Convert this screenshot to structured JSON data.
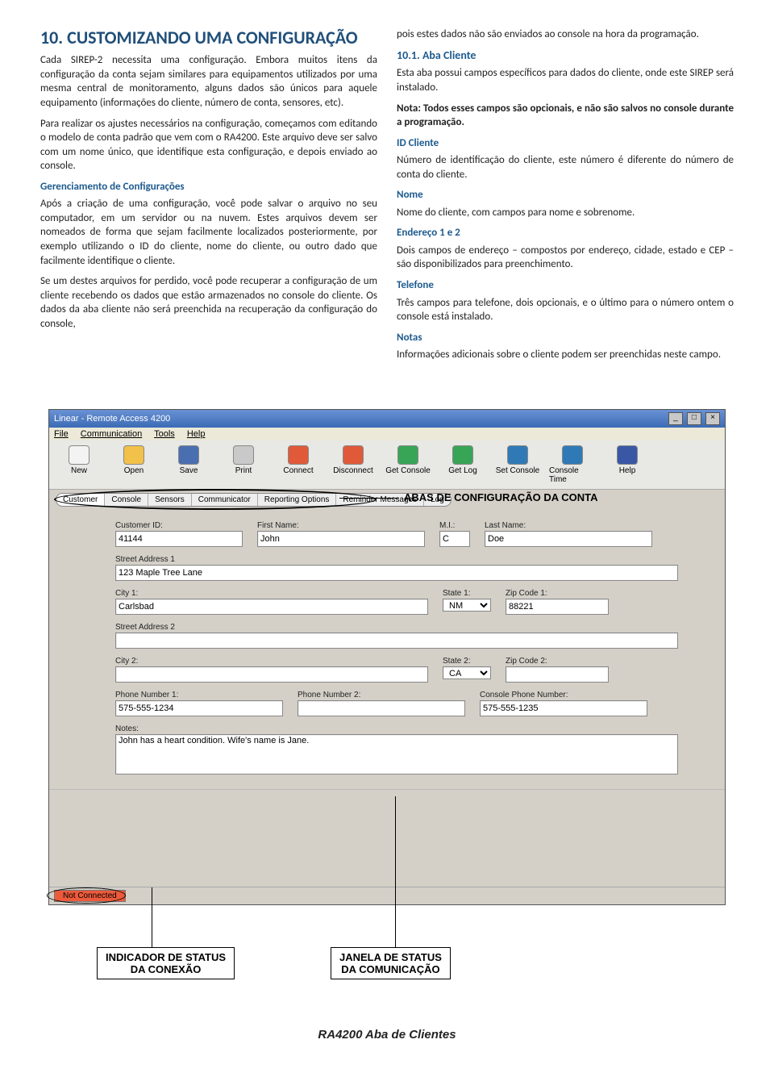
{
  "doc": {
    "section_number": "10.",
    "section_title": "CUSTOMIZANDO UMA CONFIGURAÇÃO",
    "left": {
      "p1": "Cada SIREP-2 necessita uma configuração. Embora muitos itens da configuração da conta sejam similares para equipamentos utilizados por uma mesma central de monitoramento, alguns dados são únicos para aquele equipamento (informações do cliente, número de conta, sensores, etc).",
      "p2": "Para realizar os ajustes necessários na configuração, começamos com editando o modelo de conta padrão que vem com o RA4200. Este arquivo deve ser salvo com um nome único, que identifique esta configuração, e depois enviado ao console.",
      "h_ger": "Gerenciamento de Configurações",
      "p3": "Após a criação de uma configuração, você pode salvar o arquivo no seu computador, em um servidor ou na nuvem. Estes arquivos devem ser nomeados de forma que sejam facilmente localizados posteriormente, por exemplo utilizando o ID do cliente, nome do cliente, ou outro dado que facilmente identifique o cliente.",
      "p4": "Se um destes arquivos for perdido, você pode recuperar a configuração de um cliente recebendo os dados que estão armazenados no console do cliente. Os dados da aba cliente não será preenchida na recuperação da configuração do console,"
    },
    "right": {
      "p0": "pois estes dados não são enviados ao console na hora da programação.",
      "sub_num": "10.1.",
      "sub_title": "Aba Cliente",
      "p1": "Esta aba possui campos específicos para dados do cliente, onde este SIREP será instalado.",
      "p2": "Nota: Todos esses campos são opcionais, e não são salvos no console durante a programação.",
      "h_id": "ID Cliente",
      "p_id": "Número de identificação do cliente, este número é diferente do número de conta do cliente.",
      "h_nome": "Nome",
      "p_nome": "Nome do cliente, com campos para nome e sobrenome.",
      "h_end": "Endereço 1 e 2",
      "p_end": "Dois campos de endereço – compostos por endereço, cidade, estado e CEP – são disponibilizados para preenchimento.",
      "h_tel": "Telefone",
      "p_tel": "Três campos para telefone, dois opcionais, e o último para o número ontem o console está instalado.",
      "h_notas": "Notas",
      "p_notas": "Informações adicionais sobre o cliente podem ser preenchidas neste campo."
    }
  },
  "app": {
    "title": "Linear - Remote Access 4200",
    "menu": [
      "File",
      "Communication",
      "Tools",
      "Help"
    ],
    "toolbar": [
      {
        "label": "New",
        "color": "#f3f3f3"
      },
      {
        "label": "Open",
        "color": "#f2c14a"
      },
      {
        "label": "Save",
        "color": "#4a6fb0"
      },
      {
        "label": "Print",
        "color": "#c9c9c9"
      },
      {
        "label": "Connect",
        "color": "#e05a3a"
      },
      {
        "label": "Disconnect",
        "color": "#e05a3a"
      },
      {
        "label": "Get Console",
        "color": "#38a556"
      },
      {
        "label": "Get Log",
        "color": "#38a556"
      },
      {
        "label": "Set Console",
        "color": "#2f7ab6"
      },
      {
        "label": "Console Time",
        "color": "#2f7ab6"
      },
      {
        "label": "Help",
        "color": "#3a57a6"
      }
    ],
    "tabs": [
      "Customer",
      "Console",
      "Sensors",
      "Communicator",
      "Reporting Options",
      "Reminder Messages",
      "Log"
    ],
    "tab_annotation": "ABAS DE CONFIGURAÇÃO DA CONTA",
    "form": {
      "customer_id": {
        "label": "Customer ID:",
        "value": "41144"
      },
      "first_name": {
        "label": "First Name:",
        "value": "John"
      },
      "mi": {
        "label": "M.I.:",
        "value": "C"
      },
      "last_name": {
        "label": "Last Name:",
        "value": "Doe"
      },
      "street1": {
        "label": "Street Address 1",
        "value": "123 Maple Tree Lane"
      },
      "city1": {
        "label": "City 1:",
        "value": "Carlsbad"
      },
      "state1": {
        "label": "State 1:",
        "value": "NM"
      },
      "zip1": {
        "label": "Zip Code 1:",
        "value": "88221"
      },
      "street2": {
        "label": "Street Address 2",
        "value": ""
      },
      "city2": {
        "label": "City 2:",
        "value": ""
      },
      "state2": {
        "label": "State 2:",
        "value": "CA"
      },
      "zip2": {
        "label": "Zip Code 2:",
        "value": ""
      },
      "phone1": {
        "label": "Phone Number 1:",
        "value": "575-555-1234"
      },
      "phone2": {
        "label": "Phone Number 2:",
        "value": ""
      },
      "console_phone": {
        "label": "Console Phone Number:",
        "value": "575-555-1235"
      },
      "notes": {
        "label": "Notes:",
        "value": "John has a heart condition. Wife's name is Jane."
      }
    },
    "status": "Not Connected",
    "callout_left": "INDICADOR DE STATUS DA CONEXÃO",
    "callout_right": "JANELA DE STATUS DA COMUNICAÇÃO",
    "caption": "RA4200 Aba de Clientes"
  }
}
